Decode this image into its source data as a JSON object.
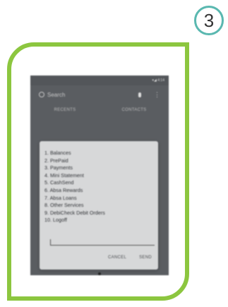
{
  "step_number": "3",
  "colors": {
    "frame": "#8cc63f",
    "badge_ring": "#5ab8b0",
    "phone_bg": "#5a5d61",
    "dialog_bg": "#d7d8d9"
  },
  "phone": {
    "status_text": "▾◢ 4:14",
    "search_placeholder": "Search",
    "more_icon": "⋮",
    "tabs": [
      "RECENTS",
      "CONTACTS"
    ],
    "ussd_menu": [
      "1. Balances",
      "2. PrePaid",
      "3. Payments",
      "4. Mini Statement",
      "5. CashSend",
      "6. Absa Rewards",
      "7. Absa Loans",
      "8. Other Services",
      "9. DebiCheck Debit Orders",
      "10. Logoff"
    ],
    "cancel_label": "CANCEL",
    "send_label": "SEND"
  }
}
